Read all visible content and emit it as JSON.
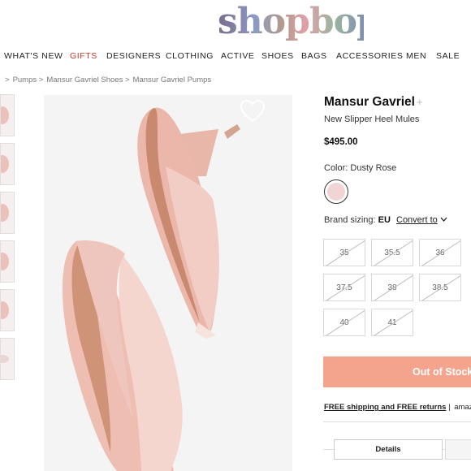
{
  "header": {
    "logo": "shopbop"
  },
  "nav": {
    "items": [
      "WHAT'S NEW",
      "GIFTS",
      "DESIGNERS",
      "CLOTHING",
      "ACTIVE",
      "SHOES",
      "BAGS",
      "ACCESSORIES",
      "MEN",
      "SALE"
    ]
  },
  "breadcrumb": {
    "sep": ">",
    "items": [
      "Pumps",
      "Mansur Gavriel Shoes",
      "Mansur Gavriel Pumps"
    ]
  },
  "product": {
    "brand": "Mansur Gavriel",
    "brand_plus": "+",
    "name": "New Slipper Heel Mules",
    "price": "$495.00",
    "color_label": "Color: Dusty Rose",
    "sizing_label": "Brand sizing:",
    "sizing_value": "EU",
    "convert_label": "Convert to",
    "sizes": [
      "35",
      "35.5",
      "36",
      "37.5",
      "38",
      "38.5",
      "40",
      "41"
    ],
    "out_of_stock_label": "Out of Stock",
    "shipping_text": "FREE shipping and FREE returns",
    "shipping_sep": "|",
    "shipping_partner": "amazon",
    "details_tab_label": "Details"
  },
  "colors": {
    "accent": "#c0392b",
    "oos_button": "#f4a48c",
    "swatch": "#f1d5d6"
  },
  "icons": {
    "wishlist": "heart-icon",
    "convert": "chevron-down-icon"
  }
}
